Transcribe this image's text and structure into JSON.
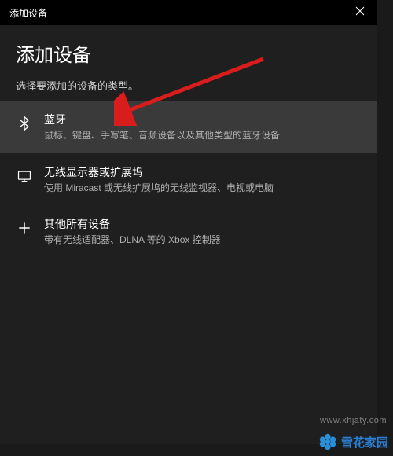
{
  "titlebar": {
    "title": "添加设备"
  },
  "header": {
    "title": "添加设备",
    "subtitle": "选择要添加的设备的类型。"
  },
  "options": [
    {
      "title": "蓝牙",
      "desc": "鼠标、键盘、手写笔、音频设备以及其他类型的蓝牙设备"
    },
    {
      "title": "无线显示器或扩展坞",
      "desc": "使用 Miracast 或无线扩展坞的无线监视器、电视或电脑"
    },
    {
      "title": "其他所有设备",
      "desc": "带有无线适配器、DLNA 等的 Xbox 控制器"
    }
  ],
  "watermarks": {
    "url": "www.xhjaty.com",
    "brand": "雪花家园"
  }
}
